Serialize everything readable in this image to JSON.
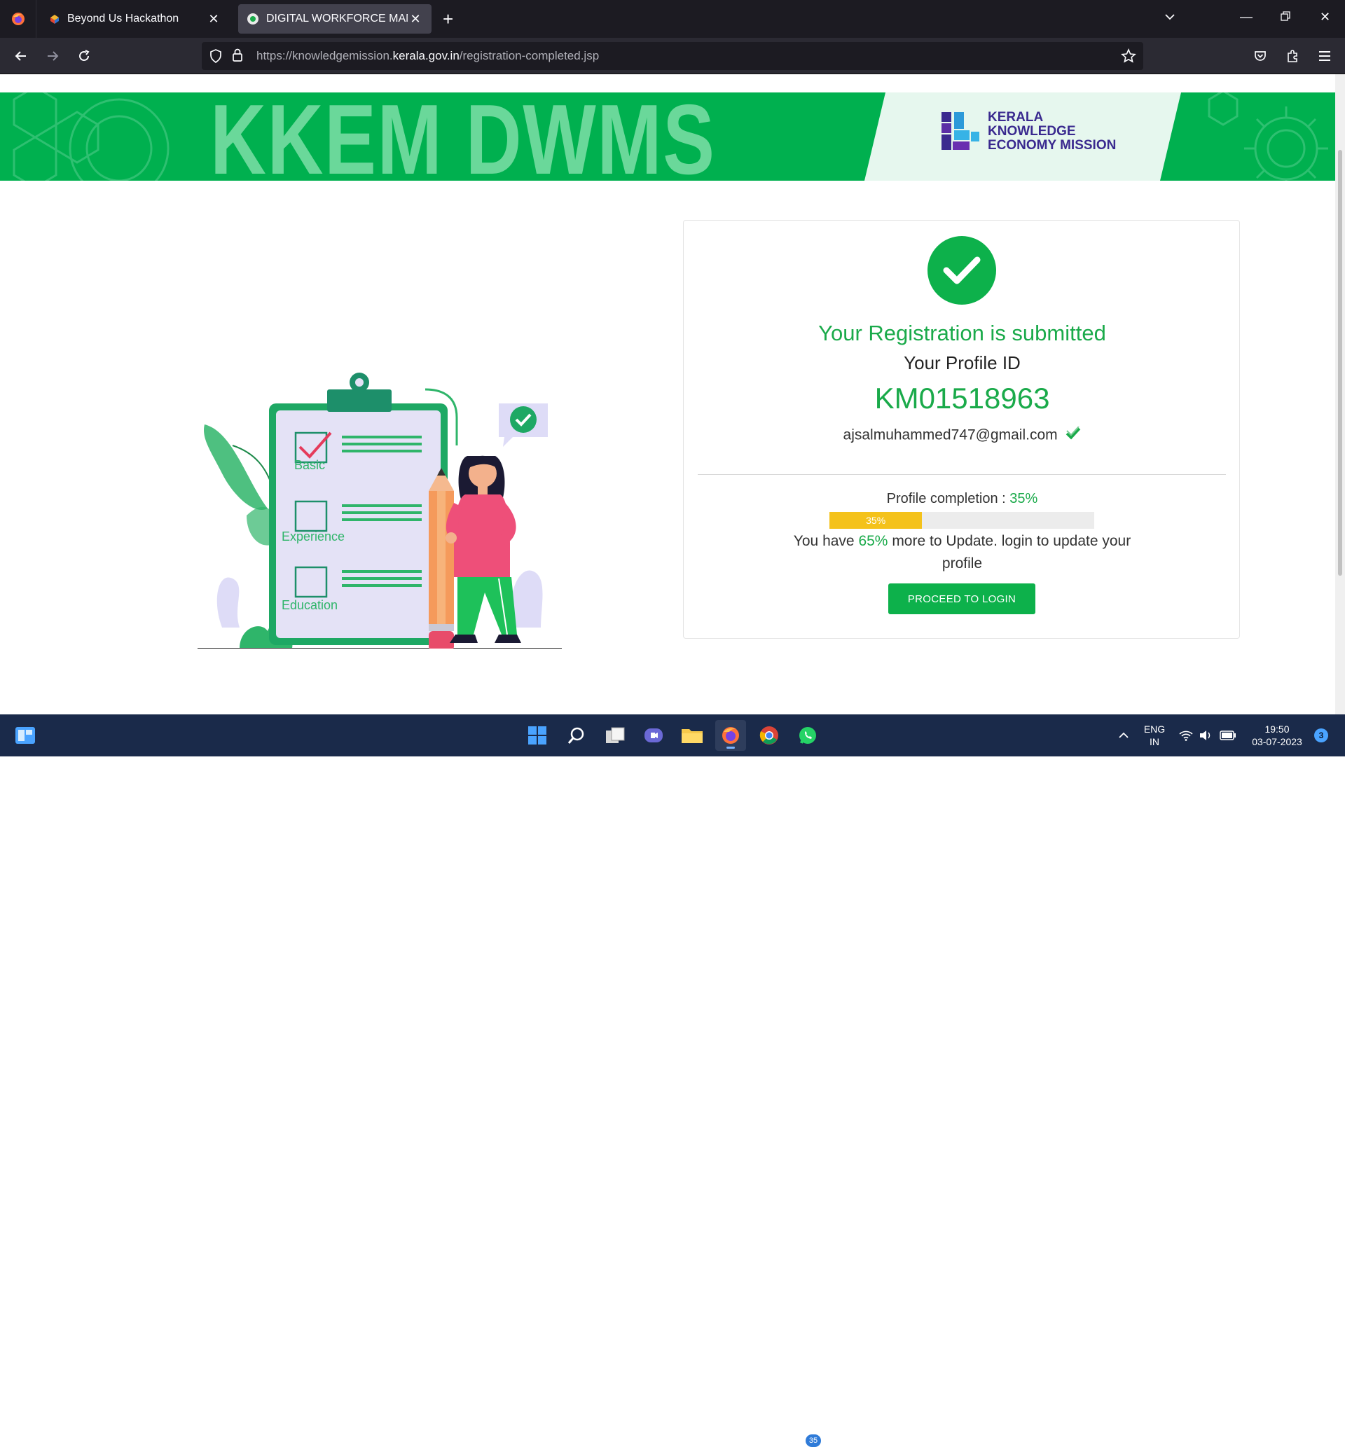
{
  "browser": {
    "tabs": [
      {
        "title": "Beyond Us Hackathon",
        "active": false
      },
      {
        "title": "DIGITAL WORKFORCE MANAGE",
        "active": true
      }
    ],
    "url_prefix": "https://knowledgemission.",
    "url_domain": "kerala.gov.in",
    "url_suffix": "/registration-completed.jsp"
  },
  "banner": {
    "title": "KKEM DWMS",
    "org_line1": "KERALA",
    "org_line2": "KNOWLEDGE",
    "org_line3": "ECONOMY MISSION",
    "colors": {
      "green": "#00b04f",
      "title": "#6ad89a",
      "org": "#3a2a8f"
    }
  },
  "illustration": {
    "labels": [
      "Basic",
      "Experience",
      "Education"
    ]
  },
  "card": {
    "title": "Your Registration is submitted",
    "profile_id_label": "Your Profile ID",
    "profile_id": "KM01518963",
    "email": "ajsalmuhammed747@gmail.com",
    "completion_label": "Profile completion : ",
    "completion_value": "35%",
    "completion_fraction": 0.35,
    "update_prefix": "You have ",
    "update_pct": "65%",
    "update_suffix": " more to Update. login to update your profile",
    "button": "PROCEED TO LOGIN",
    "accent": "#0db14b"
  },
  "taskbar": {
    "lang_line1": "ENG",
    "lang_line2": "IN",
    "time": "19:50",
    "date": "03-07-2023",
    "notifications": "3",
    "whatsapp_badge": "35"
  }
}
